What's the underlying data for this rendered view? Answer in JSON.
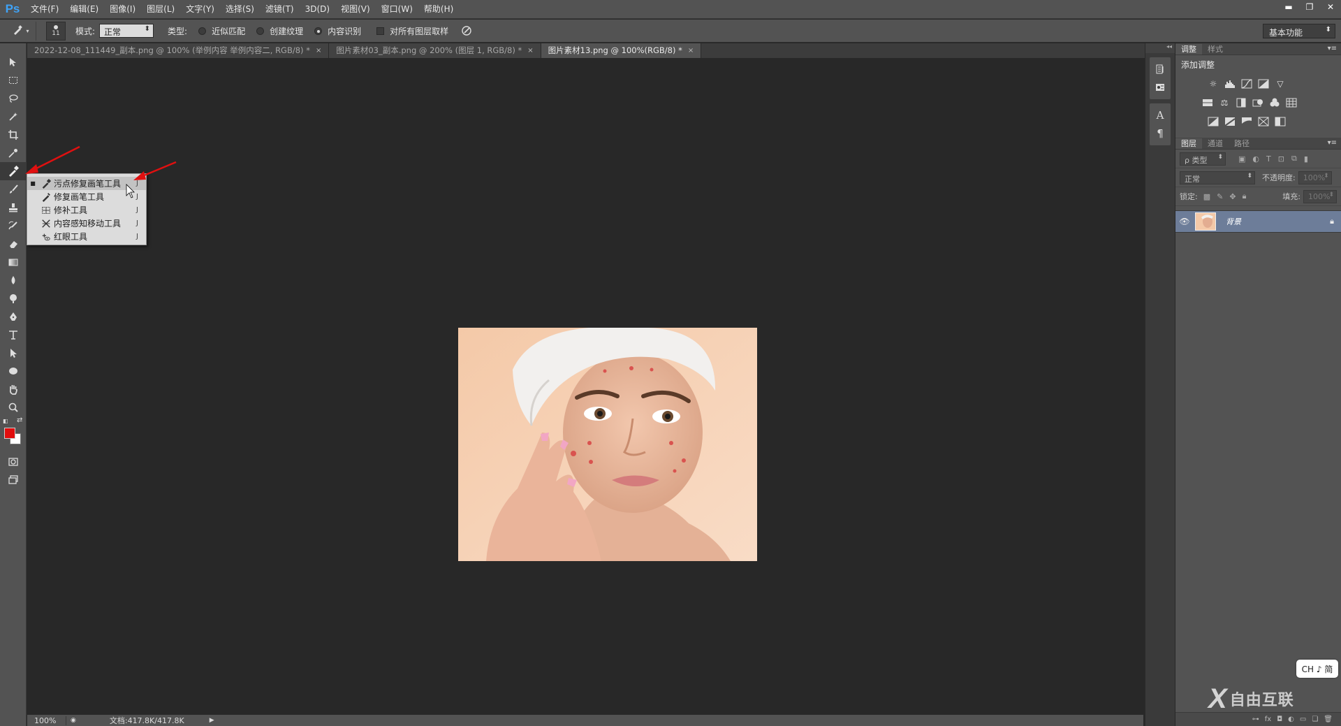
{
  "app": {
    "logo": "Ps",
    "menu": [
      "文件(F)",
      "编辑(E)",
      "图像(I)",
      "图层(L)",
      "文字(Y)",
      "选择(S)",
      "滤镜(T)",
      "3D(D)",
      "视图(V)",
      "窗口(W)",
      "帮助(H)"
    ],
    "window_controls": [
      "▬",
      "❐",
      "✕"
    ]
  },
  "options": {
    "brush_size": "11",
    "mode_label": "模式:",
    "mode_value": "正常",
    "type_label": "类型:",
    "type_options": [
      {
        "label": "近似匹配",
        "selected": false
      },
      {
        "label": "创建纹理",
        "selected": false
      },
      {
        "label": "内容识别",
        "selected": true
      }
    ],
    "sample_all_layers": "对所有图层取样",
    "workspace": "基本功能"
  },
  "tabs": [
    {
      "title": "2022-12-08_111449_副本.png @ 100% (举例内容 举例内容二, RGB/8) *",
      "close": "×",
      "active": false
    },
    {
      "title": "图片素材03_副本.png @ 200% (图层 1, RGB/8) *",
      "close": "×",
      "active": false
    },
    {
      "title": "图片素材13.png @ 100%(RGB/8) *",
      "close": "×",
      "active": true
    }
  ],
  "tool_flyout": {
    "items": [
      {
        "label": "污点修复画笔工具",
        "key": "J",
        "selected": true,
        "icon": "spot-healing-brush-icon"
      },
      {
        "label": "修复画笔工具",
        "key": "J",
        "selected": false,
        "icon": "healing-brush-icon"
      },
      {
        "label": "修补工具",
        "key": "J",
        "selected": false,
        "icon": "patch-icon"
      },
      {
        "label": "内容感知移动工具",
        "key": "J",
        "selected": false,
        "icon": "content-aware-move-icon"
      },
      {
        "label": "红眼工具",
        "key": "J",
        "selected": false,
        "icon": "red-eye-icon"
      }
    ]
  },
  "status": {
    "zoom": "100%",
    "doc": "文档:417.8K/417.8K"
  },
  "panels": {
    "adjust_tabs": [
      "调整",
      "样式"
    ],
    "adjust_title": "添加调整",
    "layer_tabs": [
      "图层",
      "通道",
      "路径"
    ],
    "filter_label": "ρ 类型",
    "blend_mode": "正常",
    "opacity_label": "不透明度:",
    "opacity_value": "100%",
    "lock_label": "锁定:",
    "fill_label": "填充:",
    "fill_value": "100%",
    "layer_name": "背景"
  },
  "colors": {
    "foreground": "#e00d0d",
    "background": "#ffffff",
    "accent_arrow": "#e01010"
  },
  "ime": "CH ♪ 简",
  "watermark": {
    "mark": "X",
    "text": "自由互联"
  }
}
